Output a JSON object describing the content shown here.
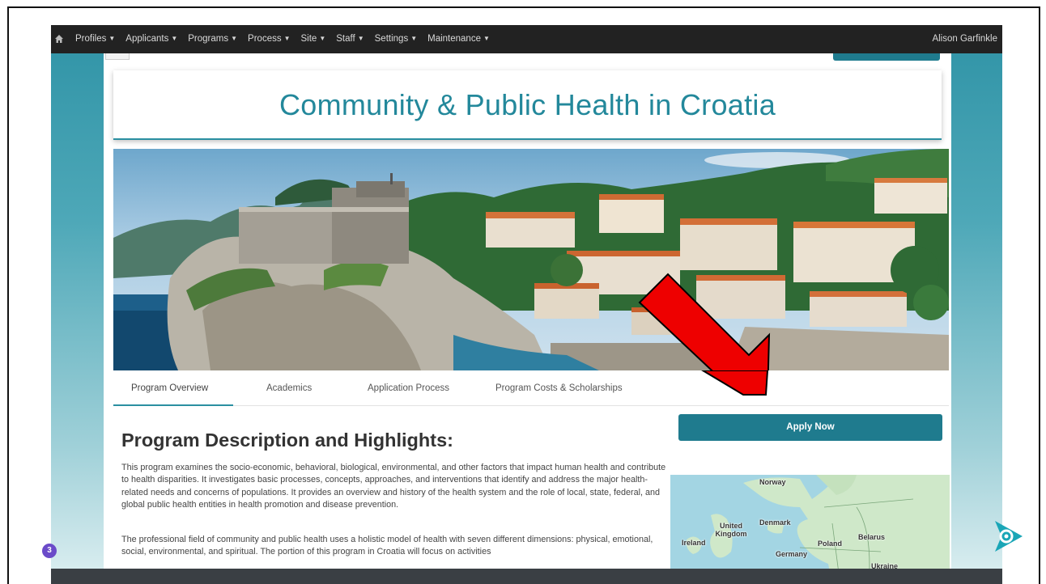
{
  "navbar": {
    "menus": [
      "Profiles",
      "Applicants",
      "Programs",
      "Process",
      "Site",
      "Staff",
      "Settings",
      "Maintenance"
    ],
    "user": "Alison Garfinkle"
  },
  "page": {
    "title": "Community & Public Health in Croatia",
    "tabs": [
      "Program Overview",
      "Academics",
      "Application Process",
      "Program Costs & Scholarships"
    ],
    "active_tab": "Program Overview",
    "apply_label": "Apply Now",
    "heading": "Program Description and Highlights:",
    "paragraphs": [
      "This program examines the socio-economic, behavioral, biological, environmental, and other factors that impact human health and contribute to health disparities. It investigates basic processes, concepts, approaches, and interventions that identify and address the major health-related needs and concerns of populations. It provides an overview and history of the health system and the role of local, state, federal, and global public health entities in health promotion and disease prevention.",
      "The professional field of community and public health uses a holistic model of health with seven different dimensions: physical, emotional, social, environmental, and spiritual. The portion of this program in Croatia will focus on activities"
    ]
  },
  "map": {
    "labels": [
      "Norway",
      "Denmark",
      "United Kingdom",
      "Ireland",
      "Belarus",
      "Poland",
      "Germany",
      "Ukraine"
    ]
  },
  "overlay": {
    "badge_count": "3",
    "arrow_color": "#ee0000",
    "logo_color": "#1aa6b7"
  },
  "colors": {
    "accent": "#23889b",
    "button": "#1f7b8e",
    "navbar": "#222222"
  }
}
